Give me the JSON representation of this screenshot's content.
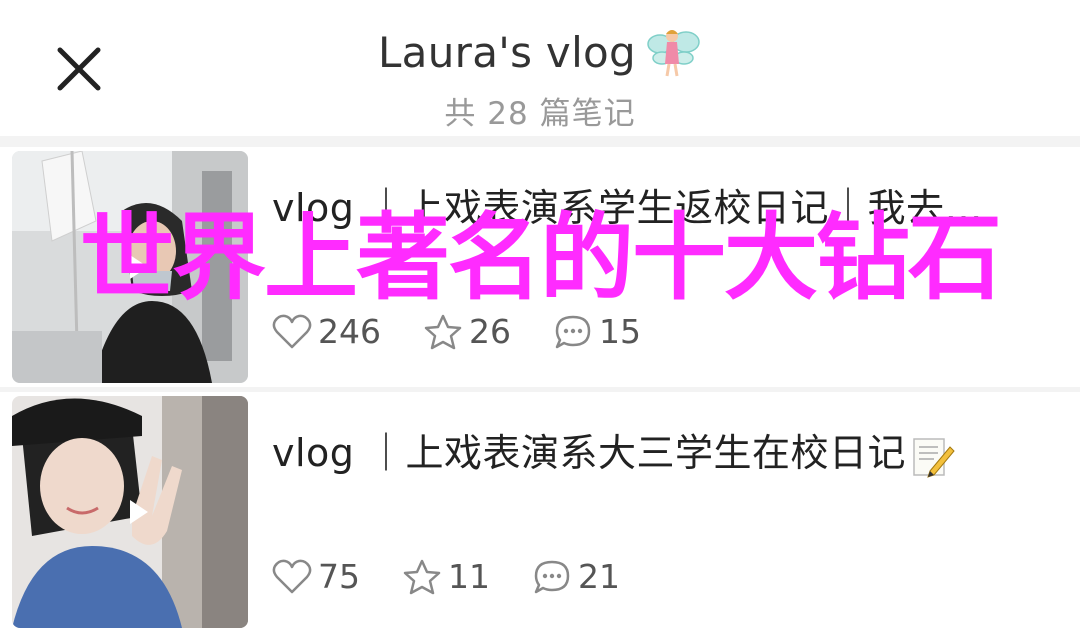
{
  "header": {
    "title": "Laura's vlog",
    "subtitle": "共 28 篇笔记",
    "title_emoji_icon": "fairy-icon",
    "close_icon": "close-icon"
  },
  "posts": [
    {
      "title": "vlog ｜上戏表演系学生返校日记｜我去…",
      "likes": "246",
      "stars": "26",
      "comments": "15",
      "thumb_icon": "play-icon"
    },
    {
      "title": "vlog ｜上戏表演系大三学生在校日记",
      "title_emoji_icon": "pencil-memo-icon",
      "likes": "75",
      "stars": "11",
      "comments": "21",
      "thumb_icon": "play-icon"
    }
  ],
  "overlay_text": "世界上著名的十大钻石",
  "colors": {
    "overlay": "#ff2bff",
    "title_text": "#333333",
    "subtitle_text": "#999999",
    "stat_text": "#555555",
    "background": "#f3f3f3"
  }
}
